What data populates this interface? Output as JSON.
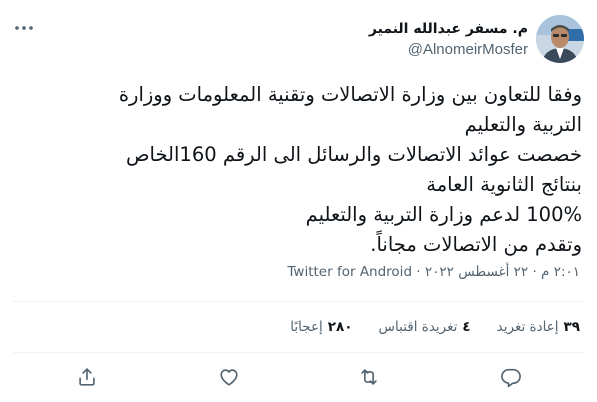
{
  "author": {
    "name": "م. مسفر عبدالله النمير",
    "handle": "@AlnomeirMosfer",
    "avatar_icon": "profile-photo"
  },
  "tweet": {
    "lines": [
      "وفقا للتعاون بين وزارة الاتصالات وتقنية المعلومات ووزارة",
      "التربية والتعليم",
      "خصصت عوائد الاتصالات والرسائل الى الرقم 160الخاص",
      "بنتائج الثانوية العامة",
      "100% لدعم وزارة التربية والتعليم",
      "وتقدم من الاتصالات مجاناً."
    ]
  },
  "meta": {
    "time": "٢:٠١ م",
    "separator1": " · ",
    "date": "٢٢ أغسطس ٢٠٢٢",
    "separator2": " · ",
    "source": "Twitter for Android"
  },
  "stats": {
    "retweets_count": "٣٩",
    "retweets_label": "إعادة تغريد",
    "quotes_count": "٤",
    "quotes_label": "تغريدة اقتباس",
    "likes_count": "٢٨٠",
    "likes_label": "إعجابًا"
  },
  "icons": {
    "more": "more-horizontal-icon",
    "reply": "reply-icon",
    "retweet": "retweet-icon",
    "like": "heart-icon",
    "share": "share-icon"
  },
  "colors": {
    "text": "#0f1419",
    "secondary": "#536471",
    "divider": "#eff3f4"
  }
}
